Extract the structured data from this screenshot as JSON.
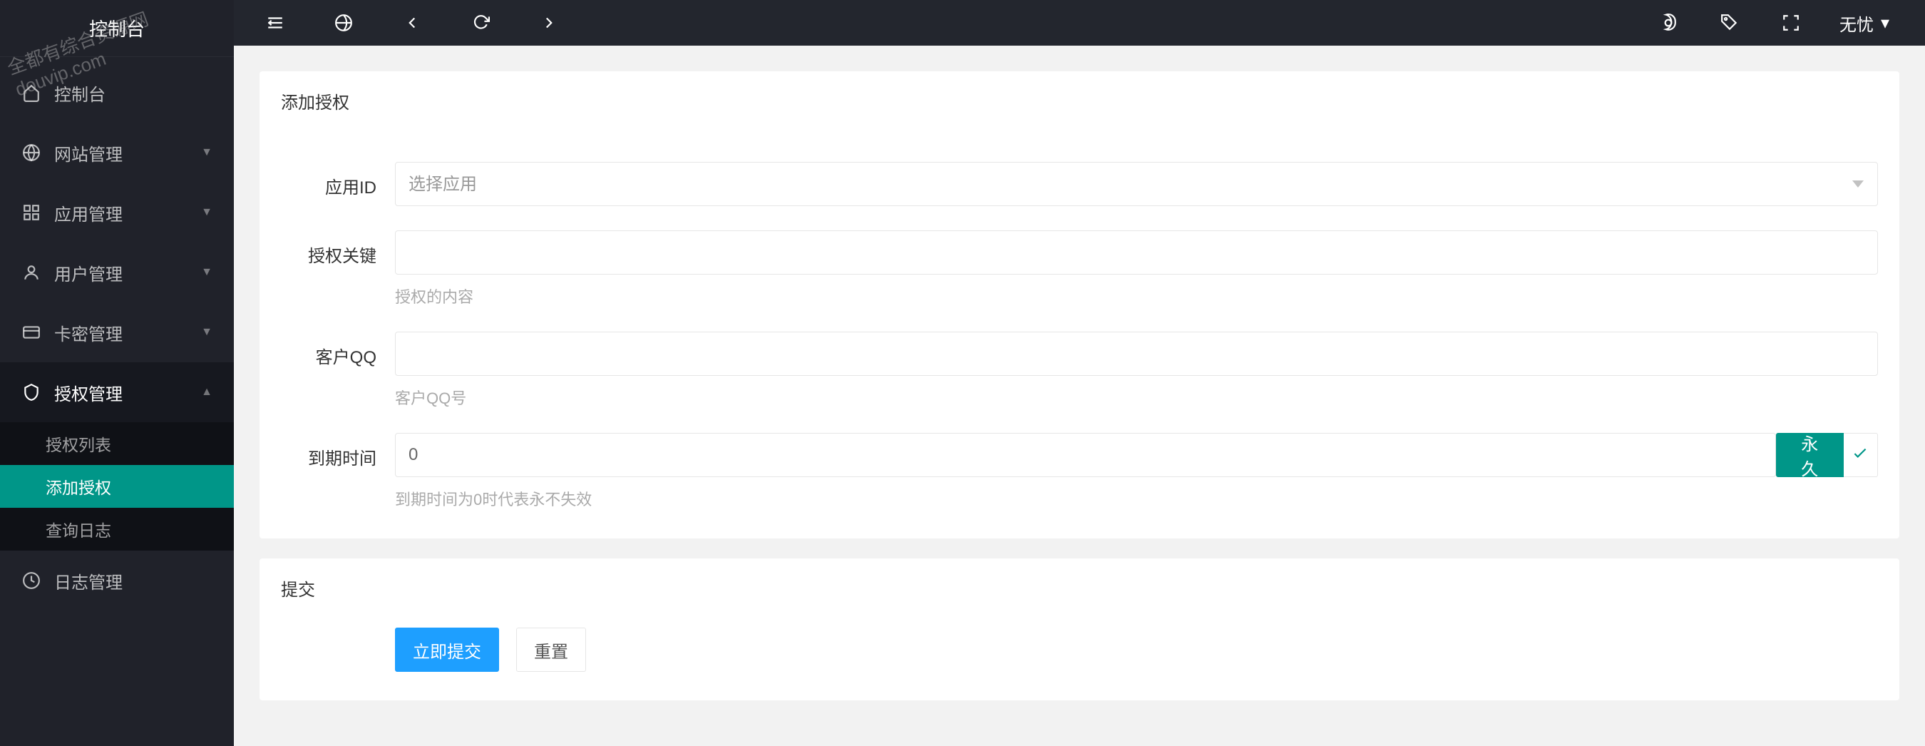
{
  "sidebar": {
    "title": "控制台",
    "items": [
      {
        "icon": "home",
        "label": "控制台",
        "chev": false
      },
      {
        "icon": "globe",
        "label": "网站管理",
        "chev": true
      },
      {
        "icon": "grid",
        "label": "应用管理",
        "chev": true
      },
      {
        "icon": "user",
        "label": "用户管理",
        "chev": true
      },
      {
        "icon": "card",
        "label": "卡密管理",
        "chev": true
      },
      {
        "icon": "shield",
        "label": "授权管理",
        "chev": true,
        "expanded": true
      },
      {
        "icon": "clock",
        "label": "日志管理",
        "chev": false
      }
    ],
    "sub": [
      {
        "label": "授权列表",
        "active": false
      },
      {
        "label": "添加授权",
        "active": true
      },
      {
        "label": "查询日志",
        "active": false
      }
    ]
  },
  "topbar": {
    "user": "无忧"
  },
  "card1": {
    "title": "添加授权",
    "appid": {
      "label": "应用ID",
      "placeholder": "选择应用"
    },
    "authkey": {
      "label": "授权关键",
      "hint": "授权的内容"
    },
    "qq": {
      "label": "客户QQ",
      "hint": "客户QQ号"
    },
    "expires": {
      "label": "到期时间",
      "value": "0",
      "hint": "到期时间为0时代表永不失效",
      "forever": "永久"
    }
  },
  "card2": {
    "title": "提交",
    "submit": "立即提交",
    "reset": "重置"
  },
  "watermark": {
    "l1": "全都有综合资源网",
    "l2": "douvip.com"
  }
}
